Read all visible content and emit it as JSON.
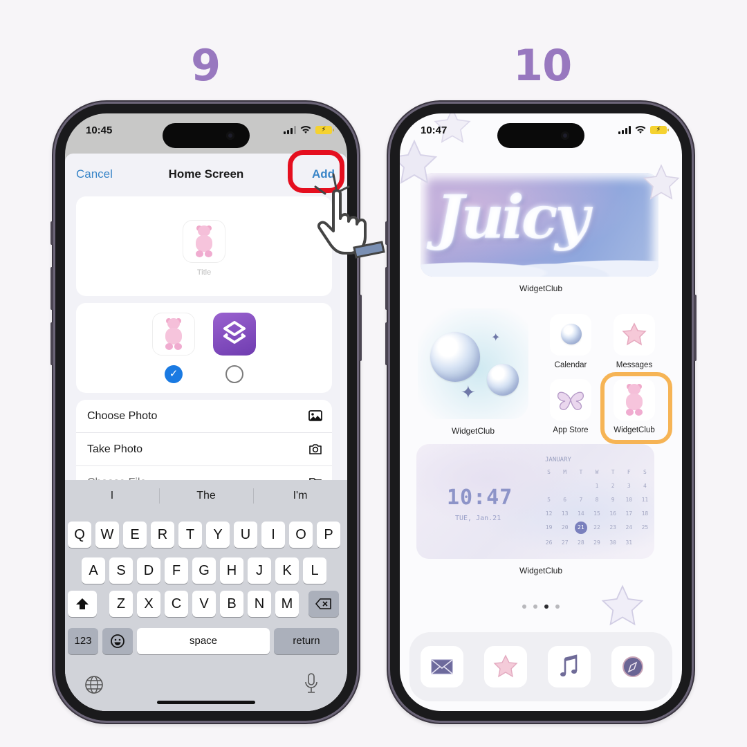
{
  "steps": {
    "left": "9",
    "right": "10"
  },
  "phone1": {
    "status": {
      "time": "10:45"
    },
    "nav": {
      "cancel": "Cancel",
      "title": "Home Screen",
      "add": "Add"
    },
    "preview": {
      "title_placeholder": "Title"
    },
    "icon_choice": {
      "options": [
        "custom-bear-icon",
        "shortcuts-icon"
      ],
      "selected": 0
    },
    "list": [
      {
        "label": "Choose Photo",
        "icon": "photo-icon"
      },
      {
        "label": "Take Photo",
        "icon": "camera-icon"
      },
      {
        "label": "Choose File",
        "icon": "folder-icon"
      }
    ],
    "keyboard": {
      "suggestions": [
        "I",
        "The",
        "I'm"
      ],
      "row1": [
        "Q",
        "W",
        "E",
        "R",
        "T",
        "Y",
        "U",
        "I",
        "O",
        "P"
      ],
      "row2": [
        "A",
        "S",
        "D",
        "F",
        "G",
        "H",
        "J",
        "K",
        "L"
      ],
      "row3": [
        "Z",
        "X",
        "C",
        "V",
        "B",
        "N",
        "M"
      ],
      "numbers": "123",
      "space": "space",
      "return": "return"
    },
    "annotation": {
      "highlight_color": "#e50f1f",
      "target": "Add"
    }
  },
  "phone2": {
    "status": {
      "time": "10:47"
    },
    "widgets": {
      "top": {
        "art_text": "Juicy",
        "label": "WidgetClub"
      },
      "bubbles": {
        "label": "WidgetClub"
      },
      "calendar": {
        "label": "WidgetClub",
        "time": "10:47",
        "date": "TUE, Jan.21",
        "month": "JANUARY",
        "weekdays": [
          "S",
          "M",
          "T",
          "W",
          "T",
          "F",
          "S"
        ],
        "leading_blanks": 3,
        "days": 31,
        "today": 21
      }
    },
    "apps": [
      {
        "name": "Calendar",
        "icon": "bubble-icon"
      },
      {
        "name": "Messages",
        "icon": "star-icon"
      },
      {
        "name": "App Store",
        "icon": "butterfly-icon"
      },
      {
        "name": "WidgetClub",
        "icon": "gummy-bear-icon",
        "highlighted": true
      }
    ],
    "page_dots": {
      "count": 4,
      "active": 2
    },
    "dock": [
      "mail-icon",
      "star-icon",
      "music-icon",
      "compass-icon"
    ],
    "annotation": {
      "highlight_color": "#f6b455"
    }
  }
}
